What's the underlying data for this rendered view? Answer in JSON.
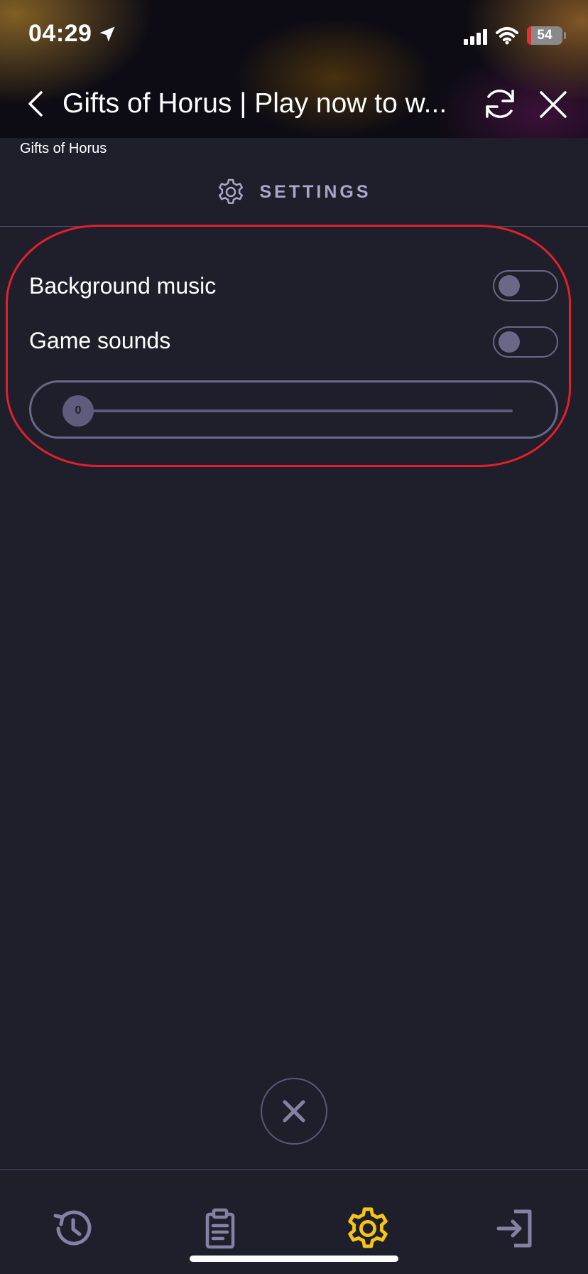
{
  "status_bar": {
    "time": "04:29",
    "battery": "54"
  },
  "header": {
    "title": "Gifts of Horus | Play now to w..."
  },
  "game_label": "Gifts of Horus",
  "settings": {
    "title": "SETTINGS",
    "background_music": {
      "label": "Background music",
      "enabled": false
    },
    "game_sounds": {
      "label": "Game sounds",
      "enabled": false
    },
    "volume": {
      "value": "0"
    }
  },
  "tabbar": {
    "items": [
      {
        "icon": "history-icon",
        "active": false
      },
      {
        "icon": "clipboard-icon",
        "active": false
      },
      {
        "icon": "gear-icon",
        "active": true
      },
      {
        "icon": "logout-icon",
        "active": false
      }
    ]
  },
  "colors": {
    "background": "#1f1f2c",
    "accent": "#f5c518",
    "muted": "#6a6887",
    "highlight": "#e3202a"
  }
}
